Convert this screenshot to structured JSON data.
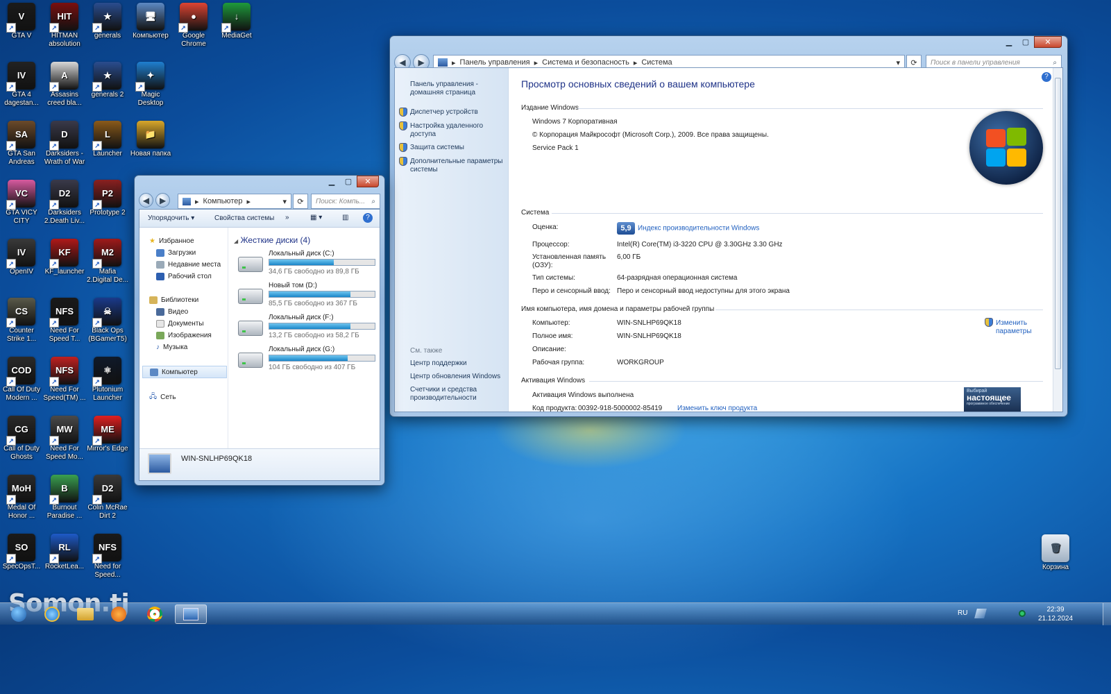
{
  "desktop": {
    "icons": [
      {
        "label": "GTA V",
        "icon": "gta-v-icon",
        "color": "#1b1b1b"
      },
      {
        "label": "HITMAN absolution",
        "icon": "hitman-icon",
        "color": "#7a0f0f"
      },
      {
        "label": "generals",
        "icon": "generals-icon",
        "color": "#2a4d8f"
      },
      {
        "label": "Компьютер",
        "icon": "computer-icon",
        "color": "#5d89c4"
      },
      {
        "label": "Google Chrome",
        "icon": "chrome-icon",
        "color": "#dd4433"
      },
      {
        "label": "MediaGet",
        "icon": "mediaget-icon",
        "color": "#1e9a3c"
      },
      {
        "label": "GTA 4 dagestan...",
        "icon": "gta-4-icon",
        "color": "#222222"
      },
      {
        "label": "Assasins creed bla...",
        "icon": "assassins-creed-icon",
        "color": "#d8d8d8"
      },
      {
        "label": "generals 2",
        "icon": "generals-2-icon",
        "color": "#2a4d8f"
      },
      {
        "label": "Magic Desktop",
        "icon": "magic-desktop-icon",
        "color": "#1f7fd0"
      },
      {
        "label": "GTA San Andreas",
        "icon": "gta-san-andreas-icon",
        "color": "#6b4a2a"
      },
      {
        "label": "Darksiders - Wrath of War",
        "icon": "darksiders-icon",
        "color": "#3a3a4a"
      },
      {
        "label": "Launcher",
        "icon": "launcher-icon",
        "color": "#8a5a1a"
      },
      {
        "label": "Новая папка",
        "icon": "folder-icon",
        "color": "#d9a72b"
      },
      {
        "label": "GTA VICY CITY",
        "icon": "gta-vice-city-icon",
        "color": "#d85aa0"
      },
      {
        "label": "Darksiders 2.Death Liv...",
        "icon": "darksiders-2-icon",
        "color": "#3a3a4a"
      },
      {
        "label": "Prototype 2",
        "icon": "prototype-2-icon",
        "color": "#8a2020"
      },
      {
        "label": "OpenIV",
        "icon": "openiv-icon",
        "color": "#3a3a3a"
      },
      {
        "label": "KF_launcher",
        "icon": "kf-launcher-icon",
        "color": "#b01818"
      },
      {
        "label": "Mafia 2.Digital De...",
        "icon": "mafia-2-icon",
        "color": "#a01a1a"
      },
      {
        "label": "Counter Strike 1...",
        "icon": "counter-strike-icon",
        "color": "#5a5a4a"
      },
      {
        "label": "Need For Speed T...",
        "icon": "nfs-icon",
        "color": "#1a1a1a"
      },
      {
        "label": "Black Ops (BGamerT5)",
        "icon": "black-ops-icon",
        "color": "#1a3a8a"
      },
      {
        "label": "Call Of Duty Modern ...",
        "icon": "call-of-duty-mw-icon",
        "color": "#2a2a2a"
      },
      {
        "label": "Need For Speed(TM) ...",
        "icon": "nfs-shift-icon",
        "color": "#c02020"
      },
      {
        "label": "Plutonium Launcher",
        "icon": "plutonium-icon",
        "color": "#101a2a"
      },
      {
        "label": "Call of Duty Ghosts",
        "icon": "cod-ghosts-icon",
        "color": "#2a2a2a"
      },
      {
        "label": "Need For Speed Mo...",
        "icon": "nfs-most-wanted-icon",
        "color": "#4a4a4a"
      },
      {
        "label": "Mirror's Edge",
        "icon": "mirrors-edge-icon",
        "color": "#e02020"
      },
      {
        "label": "Medal Of Honor ...",
        "icon": "medal-of-honor-icon",
        "color": "#2a2a2a"
      },
      {
        "label": "Burnout Paradise ...",
        "icon": "burnout-icon",
        "color": "#3aa050"
      },
      {
        "label": "Colin McRae Dirt 2",
        "icon": "dirt-2-icon",
        "color": "#3a3a3a"
      },
      {
        "label": "SpecOpsT...",
        "icon": "spec-ops-icon",
        "color": "#1a1a1a"
      },
      {
        "label": "RocketLea...",
        "icon": "rocket-league-icon",
        "color": "#1e5ac8"
      },
      {
        "label": "Need for Speed...",
        "icon": "nfs-icon-2",
        "color": "#1a1a1a"
      }
    ],
    "glyphs": [
      "V",
      "HIT",
      "★",
      "🖥",
      "●",
      "↓",
      "IV",
      "A",
      "★",
      "✦",
      "SA",
      "D",
      "L",
      "📁",
      "VC",
      "D2",
      "P2",
      "IV",
      "KF",
      "M2",
      "CS",
      "NFS",
      "☠",
      "COD",
      "NFS",
      "⚛",
      "CG",
      "MW",
      "ME",
      "MoH",
      "B",
      "D2",
      "SO",
      "RL",
      "NFS"
    ],
    "recycle_bin": "Корзина",
    "watermark": "Somon.tj"
  },
  "control_panel": {
    "breadcrumb": [
      "Панель управления",
      "Система и безопасность",
      "Система"
    ],
    "search_placeholder": "Поиск в панели управления",
    "sidebar": {
      "home": "Панель управления - домашняя страница",
      "links": [
        "Диспетчер устройств",
        "Настройка удаленного доступа",
        "Защита системы",
        "Дополнительные параметры системы"
      ],
      "see_also_title": "См. также",
      "see_also": [
        "Центр поддержки",
        "Центр обновления Windows",
        "Счетчики и средства производительности"
      ]
    },
    "title": "Просмотр основных сведений о вашем компьютере",
    "edition": {
      "heading": "Издание Windows",
      "name": "Windows 7 Корпоративная",
      "copyright": "© Корпорация Майкрософт (Microsoft Corp.), 2009. Все права защищены.",
      "service_pack": "Service Pack 1"
    },
    "system": {
      "heading": "Система",
      "rating_label": "Оценка:",
      "rating_score": "5,9",
      "rating_link": "Индекс производительности Windows",
      "cpu_label": "Процессор:",
      "cpu": "Intel(R) Core(TM) i3-3220 CPU @ 3.30GHz   3.30 GHz",
      "ram_label": "Установленная память (ОЗУ):",
      "ram": "6,00 ГБ",
      "type_label": "Тип системы:",
      "type": "64-разрядная операционная система",
      "pen_label": "Перо и сенсорный ввод:",
      "pen": "Перо и сенсорный ввод недоступны для этого экрана"
    },
    "computer_name": {
      "heading": "Имя компьютера, имя домена и параметры рабочей группы",
      "computer_label": "Компьютер:",
      "computer": "WIN-SNLHP69QK18",
      "full_label": "Полное имя:",
      "full": "WIN-SNLHP69QK18",
      "desc_label": "Описание:",
      "workgroup_label": "Рабочая группа:",
      "workgroup": "WORKGROUP",
      "change_link_1": "Изменить",
      "change_link_2": "параметры"
    },
    "activation": {
      "heading": "Активация Windows",
      "status": "Активация Windows выполнена",
      "key_label": "Код продукта:",
      "key": "00392-918-5000002-85419",
      "change_key_link": "Изменить ключ продукта",
      "badge_small": "Выбирай",
      "badge_big": "настоящее",
      "badge_sub": "программное обеспечение"
    }
  },
  "computer_window": {
    "address": "Компьютер",
    "search_placeholder": "Поиск: Компь...",
    "toolbar": {
      "organize": "Упорядочить",
      "properties": "Свойства системы",
      "more": "»"
    },
    "nav": {
      "favorites": "Избранное",
      "favorites_items": [
        "Загрузки",
        "Недавние места",
        "Рабочий стол"
      ],
      "libraries": "Библиотеки",
      "libraries_items": [
        "Видео",
        "Документы",
        "Изображения",
        "Музыка"
      ],
      "computer": "Компьютер",
      "network": "Сеть"
    },
    "group_title": "Жесткие диски (4)",
    "drives": [
      {
        "name": "Локальный диск (C:)",
        "free": "34,6 ГБ свободно из 89,8 ГБ",
        "used_fraction": 0.615
      },
      {
        "name": "Новый том (D:)",
        "free": "85,5 ГБ свободно из 367 ГБ",
        "used_fraction": 0.767
      },
      {
        "name": "Локальный диск (F:)",
        "free": "13,2 ГБ свободно из 58,2 ГБ",
        "used_fraction": 0.773
      },
      {
        "name": "Локальный диск (G:)",
        "free": "104 ГБ свободно из 407 ГБ",
        "used_fraction": 0.744
      }
    ],
    "details_name": "WIN-SNLHP69QK18"
  },
  "taskbar": {
    "lang": "RU",
    "time": "22:39",
    "date": "21.12.2024"
  }
}
